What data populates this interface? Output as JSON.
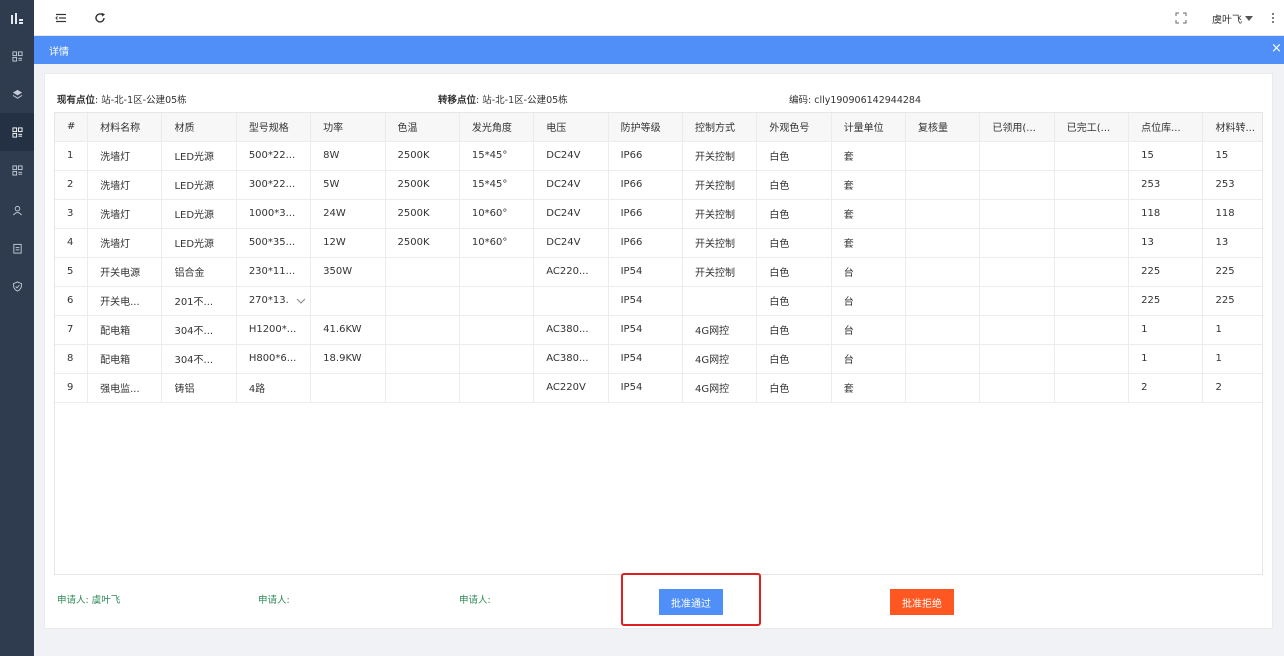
{
  "sidebar": {
    "logo": "li",
    "items": [
      {
        "icon": "grid-doc-icon",
        "active": false
      },
      {
        "icon": "layers-icon",
        "active": false
      },
      {
        "icon": "grid-doc-icon",
        "active": true
      },
      {
        "icon": "grid-doc-icon",
        "active": false
      },
      {
        "icon": "user-icon",
        "active": false
      },
      {
        "icon": "clipboard-icon",
        "active": false
      },
      {
        "icon": "shield-icon",
        "active": false
      }
    ]
  },
  "header": {
    "menu_icon": "menu-collapse-icon",
    "refresh_icon": "refresh-icon",
    "fullscreen_icon": "fullscreen-icon",
    "user_name": "虞叶飞",
    "more_icon": "more-vertical-icon"
  },
  "detail": {
    "title": "详情",
    "close_symbol": "×"
  },
  "info": {
    "current_label": "现有点位",
    "current_value": ": 站-北-1区-公建05栋",
    "transfer_label": "转移点位",
    "transfer_value": ": 站-北-1区-公建05栋",
    "code_text": "编码: clly190906142944284"
  },
  "table": {
    "columns": [
      "#",
      "材料名称",
      "材质",
      "型号规格",
      "功率",
      "色温",
      "发光角度",
      "电压",
      "防护等级",
      "控制方式",
      "外观色号",
      "计量单位",
      "复核量",
      "已领用(...",
      "已完工(...",
      "点位库...",
      "材料转..."
    ],
    "rows": [
      [
        "1",
        "洗墙灯",
        "LED光源",
        "500*22...",
        "8W",
        "2500K",
        "15*45°",
        "DC24V",
        "IP66",
        "开关控制",
        "白色",
        "套",
        "",
        "",
        "",
        "15",
        "15"
      ],
      [
        "2",
        "洗墙灯",
        "LED光源",
        "300*22...",
        "5W",
        "2500K",
        "15*45°",
        "DC24V",
        "IP66",
        "开关控制",
        "白色",
        "套",
        "",
        "",
        "",
        "253",
        "253"
      ],
      [
        "3",
        "洗墙灯",
        "LED光源",
        "1000*3...",
        "24W",
        "2500K",
        "10*60°",
        "DC24V",
        "IP66",
        "开关控制",
        "白色",
        "套",
        "",
        "",
        "",
        "118",
        "118"
      ],
      [
        "4",
        "洗墙灯",
        "LED光源",
        "500*35...",
        "12W",
        "2500K",
        "10*60°",
        "DC24V",
        "IP66",
        "开关控制",
        "白色",
        "套",
        "",
        "",
        "",
        "13",
        "13"
      ],
      [
        "5",
        "开关电源",
        "铝合金",
        "230*11...",
        "350W",
        "",
        "",
        "AC220...",
        "IP54",
        "开关控制",
        "白色",
        "台",
        "",
        "",
        "",
        "225",
        "225"
      ],
      [
        "6",
        "开关电...",
        "201不...",
        "270*13.",
        "",
        "",
        "",
        "",
        "IP54",
        "",
        "白色",
        "台",
        "",
        "",
        "",
        "225",
        "225"
      ],
      [
        "7",
        "配电箱",
        "304不...",
        "H1200*...",
        "41.6KW",
        "",
        "",
        "AC380...",
        "IP54",
        "4G网控",
        "白色",
        "台",
        "",
        "",
        "",
        "1",
        "1"
      ],
      [
        "8",
        "配电箱",
        "304不...",
        "H800*6...",
        "18.9KW",
        "",
        "",
        "AC380...",
        "IP54",
        "4G网控",
        "白色",
        "台",
        "",
        "",
        "",
        "1",
        "1"
      ],
      [
        "9",
        "强电监...",
        "铸铝",
        "4路",
        "",
        "",
        "",
        "AC220V",
        "IP54",
        "4G网控",
        "白色",
        "套",
        "",
        "",
        "",
        "2",
        "2"
      ]
    ]
  },
  "footer": {
    "applicant1": "申请人: 虞叶飞",
    "applicant2": "申请人:",
    "applicant3": "申请人:",
    "approve_label": "批准通过",
    "reject_label": "批准拒绝"
  }
}
